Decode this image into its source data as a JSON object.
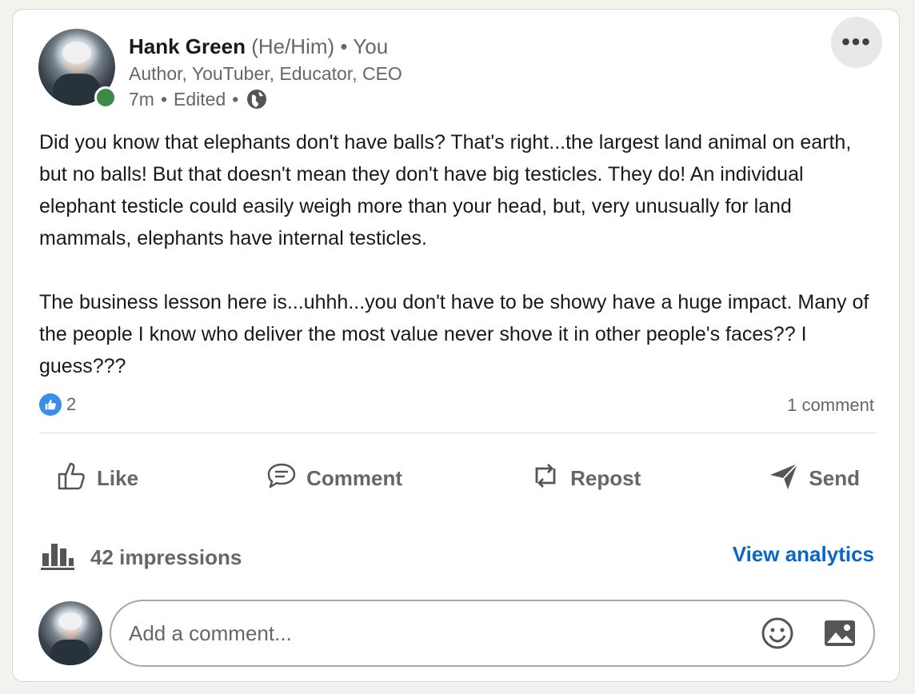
{
  "post": {
    "author_name": "Hank Green",
    "pronouns": "(He/Him)",
    "separator": "•",
    "relation": "You",
    "headline": "Author, YouTuber, Educator, CEO",
    "time": "7m",
    "edited": "Edited",
    "visibility_icon": "globe-icon",
    "more_icon": "ellipsis-icon",
    "body": "Did you know that elephants don't have balls? That's right...the largest land animal on earth, but no balls! But that doesn't mean they don't have big testicles. They do! An individual elephant testicle could easily weigh more than your head, but, very unusually for land mammals, elephants have internal testicles.\n\nThe business lesson here is...uhhh...you don't have to be showy have a huge impact. Many of the people I know who deliver the most value never shove it in other people's faces?? I guess???"
  },
  "social": {
    "reaction_icon": "like-reaction-icon",
    "reaction_count": "2",
    "comments": "1 comment"
  },
  "actions": [
    {
      "label": "Like",
      "icon": "thumbs-up-icon"
    },
    {
      "label": "Comment",
      "icon": "comment-icon"
    },
    {
      "label": "Repost",
      "icon": "repost-icon"
    },
    {
      "label": "Send",
      "icon": "send-icon"
    }
  ],
  "analytics": {
    "impressions": "42 impressions",
    "icon": "bar-chart-icon",
    "link": "View analytics"
  },
  "comment_box": {
    "placeholder": "Add a comment...",
    "value": "",
    "emoji_icon": "emoji-icon",
    "image_icon": "image-icon"
  },
  "colors": {
    "accent": "#0a66c2",
    "presence": "#3c8a46",
    "reaction": "#378fe9"
  }
}
